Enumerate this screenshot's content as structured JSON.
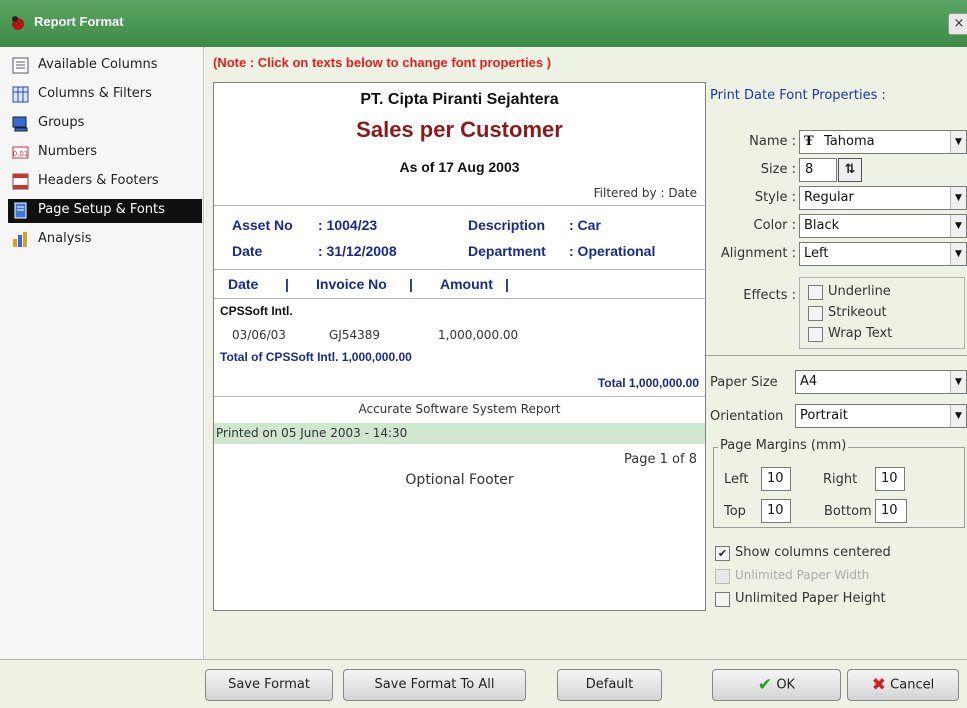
{
  "window": {
    "title": "Report Format",
    "close_label": "×"
  },
  "sidebar": {
    "items": [
      {
        "label": "Available Columns"
      },
      {
        "label": "Columns & Filters"
      },
      {
        "label": "Groups"
      },
      {
        "label": "Numbers"
      },
      {
        "label": "Headers & Footers"
      },
      {
        "label": "Page Setup & Fonts"
      },
      {
        "label": "Analysis"
      }
    ]
  },
  "note": "(Note : Click on texts below to change font properties )",
  "preview": {
    "company": "PT. Cipta Piranti Sejahtera",
    "report_title": "Sales per Customer",
    "as_of": "As of 17 Aug 2003",
    "filtered_by": "Filtered by : Date",
    "asset_label": "Asset No",
    "asset_value": ": 1004/23",
    "description_label": "Description",
    "description_value": ": Car",
    "date_label": "Date",
    "date_value": ": 31/12/2008",
    "department_label": "Department",
    "department_value": ": Operational",
    "col_date": "Date",
    "col_sep": "|",
    "col_invoice": "Invoice No",
    "col_sep2": "|",
    "col_amount": "Amount",
    "col_sep3": "|",
    "group_name": "CPSSoft Intl.",
    "row_date": "03/06/03",
    "row_invoice": "GJ54389",
    "row_amount": "1,000,000.00",
    "group_total": "Total of CPSSoft Intl. 1,000,000.00",
    "grand_total": "Total 1,000,000.00",
    "footer_system": "Accurate Software System Report",
    "printed_on": "Printed on 05 June 2003 - 14:30",
    "page_info": "Page 1 of 8",
    "optional_footer": "Optional Footer"
  },
  "font_props": {
    "header": "Print Date Font Properties :",
    "name_label": "Name :",
    "name_value": "Tahoma",
    "size_label": "Size :",
    "size_value": "8",
    "style_label": "Style :",
    "style_value": "Regular",
    "color_label": "Color :",
    "color_value": "Black",
    "alignment_label": "Alignment :",
    "alignment_value": "Left",
    "effects_label": "Effects :",
    "effects": [
      "Underline",
      "Strikeout",
      "Wrap Text"
    ]
  },
  "page_setup": {
    "paper_size_label": "Paper Size",
    "paper_size_value": "A4",
    "orientation_label": "Orientation",
    "orientation_value": "Portrait",
    "margins_label": "Page Margins (mm)",
    "left_label": "Left",
    "left_value": "10",
    "right_label": "Right",
    "right_value": "10",
    "top_label": "Top",
    "top_value": "10",
    "bottom_label": "Bottom",
    "bottom_value": "10",
    "show_centered": "Show columns centered",
    "unlimited_width": "Unlimited Paper Width",
    "unlimited_height": "Unlimited Paper Height"
  },
  "buttons": {
    "save_format": "Save Format",
    "save_format_all": "Save Format To All",
    "default": "Default",
    "ok": "OK",
    "cancel": "Cancel"
  },
  "colors": {
    "title_bar": "#4a9a54",
    "note": "#e02020",
    "report_title": "#8b1a1a",
    "navy": "#1a2a8c",
    "printed_band": "#cfe6cf"
  }
}
